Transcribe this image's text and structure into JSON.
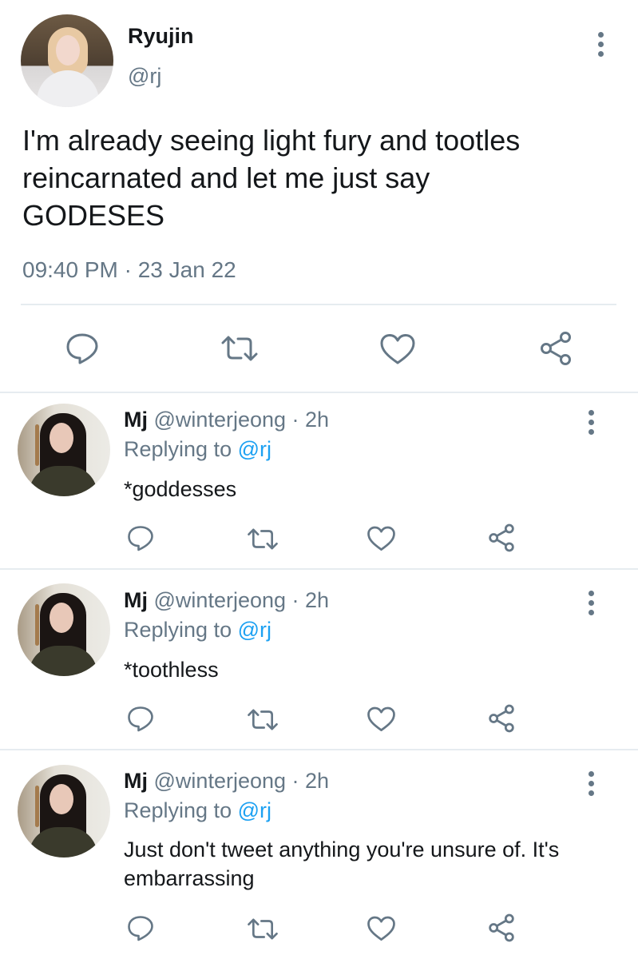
{
  "tweet": {
    "author_name": "Ryujin",
    "author_handle": "@rj",
    "text": "I'm already seeing light fury and tootles\nreincarnated and let me just say\nGODESES",
    "timestamp": "09:40 PM · 23 Jan 22"
  },
  "icons": {
    "reply": "reply-icon",
    "retweet": "retweet-icon",
    "like": "heart-icon",
    "share": "share-icon",
    "more": "more-vertical-icon"
  },
  "colors": {
    "text": "#14171a",
    "muted": "#657786",
    "link": "#1da1f2",
    "divider": "#e6ecf0"
  },
  "replies": [
    {
      "name": "Mj",
      "handle": "@winterjeong",
      "time": "· 2h",
      "replying_label": "Replying to",
      "replying_to": "@rj",
      "text": "*goddesses"
    },
    {
      "name": "Mj",
      "handle": "@winterjeong",
      "time": "· 2h",
      "replying_label": "Replying to",
      "replying_to": "@rj",
      "text": "*toothless"
    },
    {
      "name": "Mj",
      "handle": "@winterjeong",
      "time": "· 2h",
      "replying_label": "Replying to",
      "replying_to": "@rj",
      "text": "Just don't tweet anything you're unsure of. It's embarrassing"
    }
  ]
}
